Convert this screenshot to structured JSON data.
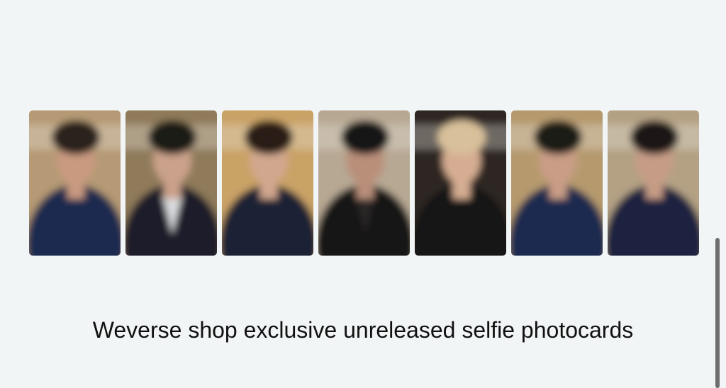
{
  "caption": "Weverse shop exclusive unreleased selfie photocards",
  "photocards": [
    {
      "name": "photocard-1",
      "bg": "#b59a74",
      "hair": "#2b221c",
      "skin": "#c99a80",
      "top": "#1d2c4f",
      "inner": "#1d2c4f"
    },
    {
      "name": "photocard-2",
      "bg": "#8f7a5a",
      "hair": "#1f1a16",
      "skin": "#caa18a",
      "top": "#1a1c2a",
      "inner": "#d9dcde"
    },
    {
      "name": "photocard-3",
      "bg": "#c9a266",
      "hair": "#2a1f18",
      "skin": "#d1a78e",
      "top": "#1b2036",
      "inner": "#1b2036"
    },
    {
      "name": "photocard-4",
      "bg": "#b7a893",
      "hair": "#161414",
      "skin": "#b98f7a",
      "top": "#141316",
      "inner": "#2a2526"
    },
    {
      "name": "photocard-5",
      "bg": "#2d2724",
      "hair": "#d8c09a",
      "skin": "#d6ad92",
      "top": "#151518",
      "inner": "#151518"
    },
    {
      "name": "photocard-6",
      "bg": "#b69a6e",
      "hair": "#1e1a18",
      "skin": "#c99d86",
      "top": "#1c2a4f",
      "inner": "#1c2a4f"
    },
    {
      "name": "photocard-7",
      "bg": "#b4a184",
      "hair": "#1b1816",
      "skin": "#c69c86",
      "top": "#1b2440",
      "inner": "#1b2440"
    }
  ]
}
